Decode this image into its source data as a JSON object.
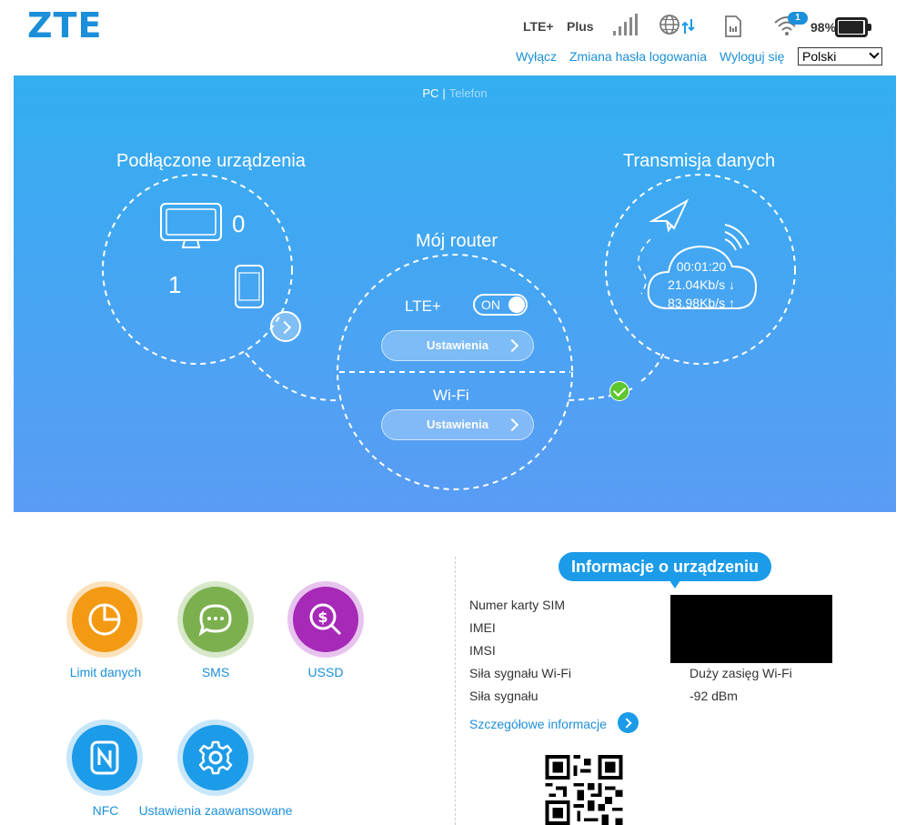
{
  "header": {
    "logo": "ZTE",
    "network_type": "LTE+",
    "operator": "Plus",
    "wifi_clients_badge": "1",
    "battery": "98%",
    "battery_level": 0.98,
    "links": {
      "power_off": "Wyłącz",
      "change_password": "Zmiana hasła logowania",
      "logout": "Wyloguj się"
    },
    "language": "Polski"
  },
  "banner": {
    "view_pc": "PC",
    "view_sep": "|",
    "view_phone": "Telefon",
    "connected_title": "Podłączone urządzenia",
    "wired_count": "0",
    "wireless_count": "1",
    "router_title": "Mój router",
    "lte_label": "LTE+",
    "lte_toggle": "ON",
    "settings_label": "Ustawienia",
    "wifi_label": "Wi-Fi",
    "transfer_title": "Transmisja danych",
    "conn_time": "00:01:20",
    "download": "21.04Kb/s ↓",
    "upload": "83.98Kb/s ↑"
  },
  "quick_menu": {
    "data_limit": "Limit danych",
    "sms": "SMS",
    "ussd": "USSD",
    "nfc": "NFC",
    "advanced": "Ustawienia zaawansowane"
  },
  "device_info": {
    "title": "Informacje o urządzeniu",
    "rows": [
      {
        "key": "Numer karty SIM",
        "value": ""
      },
      {
        "key": "IMEI",
        "value": ""
      },
      {
        "key": "IMSI",
        "value": ""
      },
      {
        "key": "Siła sygnału Wi-Fi",
        "value": "Duży zasięg Wi-Fi"
      },
      {
        "key": "Siła sygnału",
        "value": "-92 dBm"
      }
    ],
    "details_link": "Szczegółowe informacje"
  },
  "colors": {
    "brand": "#1b8fd9",
    "banner_top": "#33aef0",
    "banner_bottom": "#5a9cf5",
    "data_limit": "#f39a12",
    "sms": "#7cb04f",
    "ussd": "#a629b8",
    "nfc": "#1b9be8",
    "advanced": "#1b9be8"
  }
}
